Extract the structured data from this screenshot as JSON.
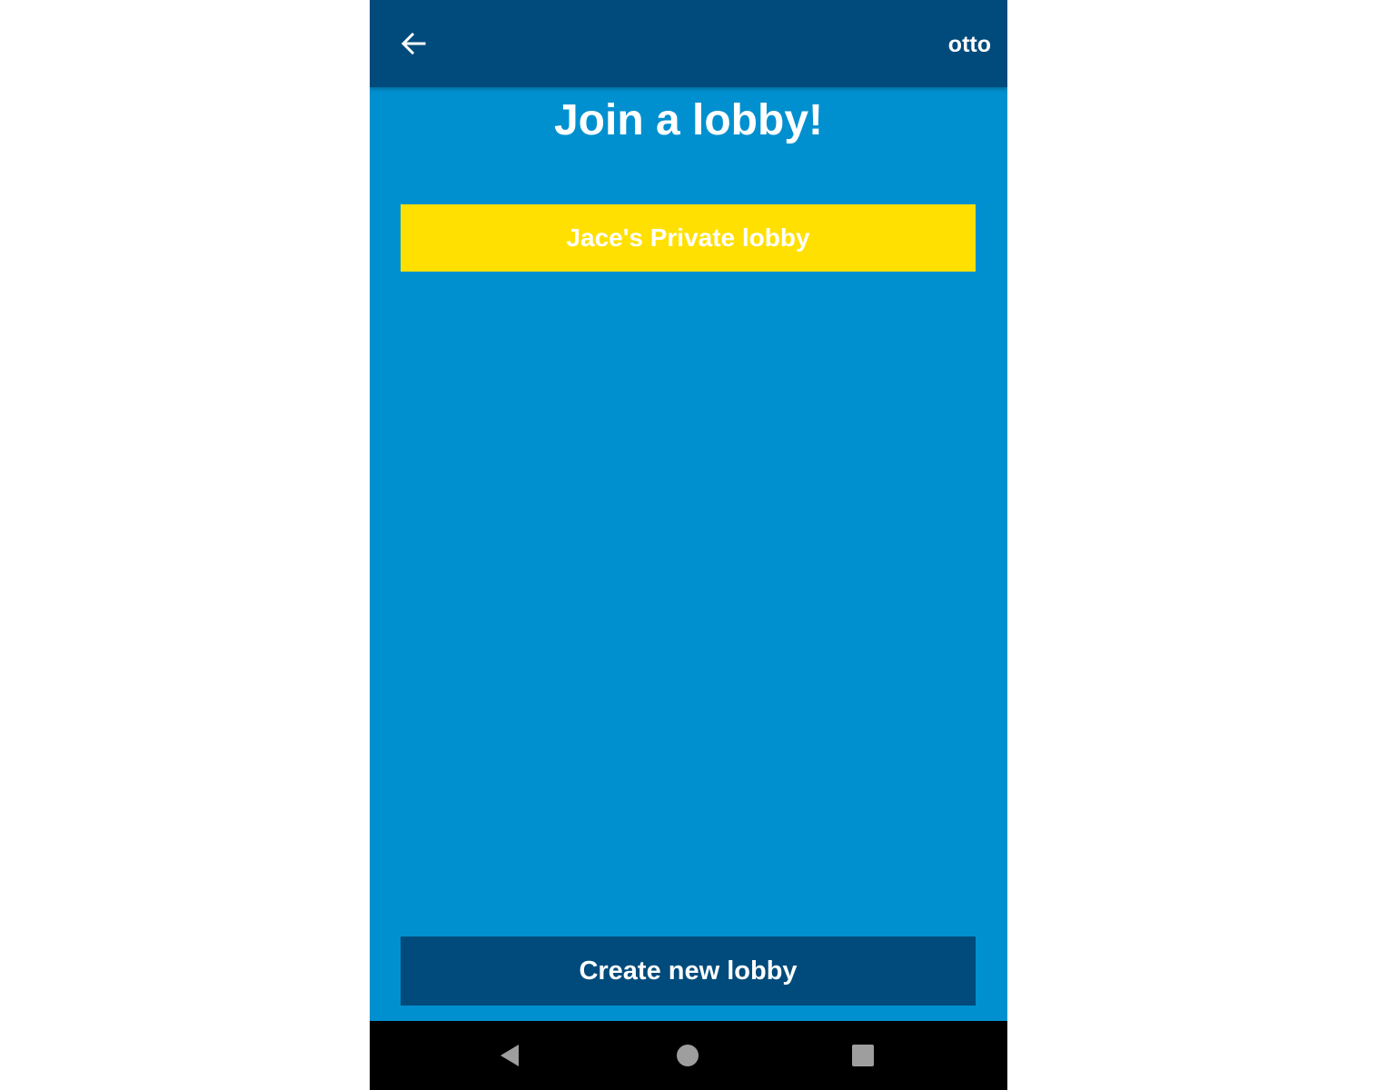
{
  "appbar": {
    "back_icon": "arrow-left-icon",
    "username": "otto"
  },
  "page": {
    "title": "Join a lobby!"
  },
  "lobbies": [
    {
      "name": "Jace's Private lobby"
    }
  ],
  "actions": {
    "create_label": "Create new lobby"
  },
  "system_nav": {
    "back_icon": "triangle-back-icon",
    "home_icon": "circle-home-icon",
    "recents_icon": "square-recents-icon"
  },
  "colors": {
    "background": "#0090cf",
    "appbar": "#004b7c",
    "lobby_item": "#ffe000",
    "create_button": "#004b7c",
    "text": "#ffffff",
    "system_nav": "#000000",
    "system_nav_icons": "#9e9e9e"
  }
}
